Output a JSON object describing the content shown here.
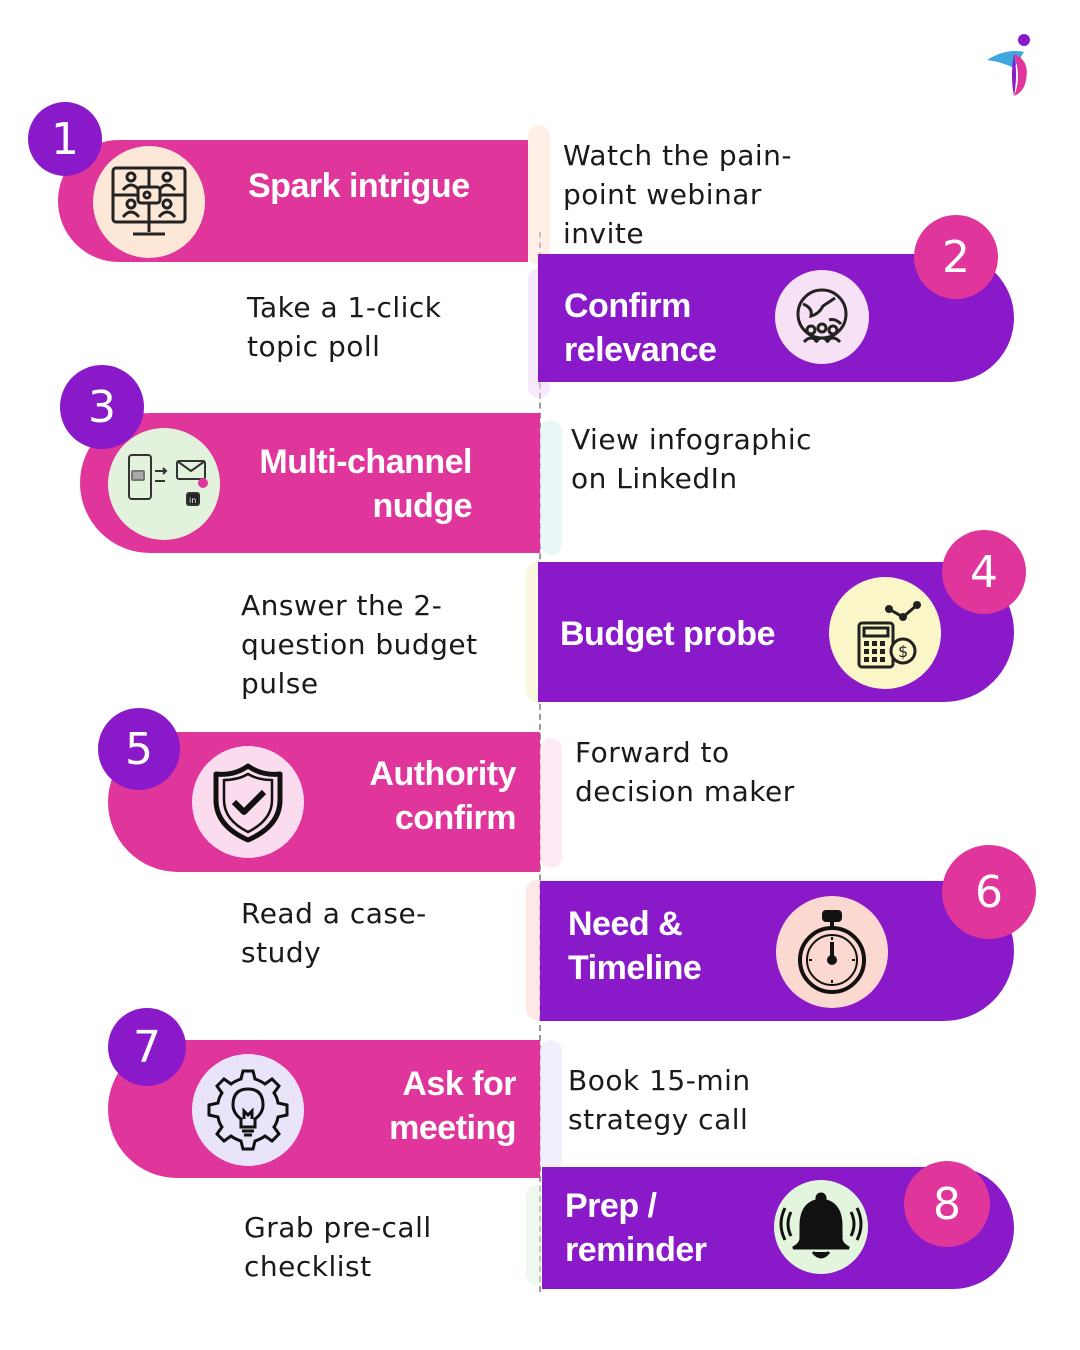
{
  "colors": {
    "pink": "#e0369b",
    "purple": "#8a19c9",
    "text": "#1a1a1a"
  },
  "logo": {
    "icon": "brand-logo"
  },
  "steps": [
    {
      "number": "1",
      "title_line1": "Spark intrigue",
      "title_line2": "",
      "icon": "video-conference-icon",
      "description": [
        "Watch the pain-",
        "point webinar",
        "invite"
      ]
    },
    {
      "number": "2",
      "title_line1": "Confirm",
      "title_line2": "relevance",
      "icon": "globe-people-icon",
      "description": [
        "Take a 1-click",
        "topic poll"
      ]
    },
    {
      "number": "3",
      "title_line1": "Multi-channel",
      "title_line2": "nudge",
      "icon": "multichannel-icon",
      "description": [
        "View infographic",
        "on LinkedIn"
      ]
    },
    {
      "number": "4",
      "title_line1": "Budget probe",
      "title_line2": "",
      "icon": "calculator-money-icon",
      "description": [
        "Answer the 2-",
        "question budget",
        "pulse"
      ]
    },
    {
      "number": "5",
      "title_line1": "Authority",
      "title_line2": "confirm",
      "icon": "shield-check-icon",
      "description": [
        "Forward to",
        "decision maker"
      ]
    },
    {
      "number": "6",
      "title_line1": "Need &",
      "title_line2": "Timeline",
      "icon": "stopwatch-icon",
      "description": [
        "Read a case-",
        "study"
      ]
    },
    {
      "number": "7",
      "title_line1": "Ask for",
      "title_line2": "meeting",
      "icon": "lightbulb-gear-icon",
      "description": [
        "Book 15-min",
        "strategy call"
      ]
    },
    {
      "number": "8",
      "title_line1": "Prep /",
      "title_line2": "reminder",
      "icon": "bell-icon",
      "description": [
        "Grab pre-call",
        "checklist"
      ]
    }
  ]
}
